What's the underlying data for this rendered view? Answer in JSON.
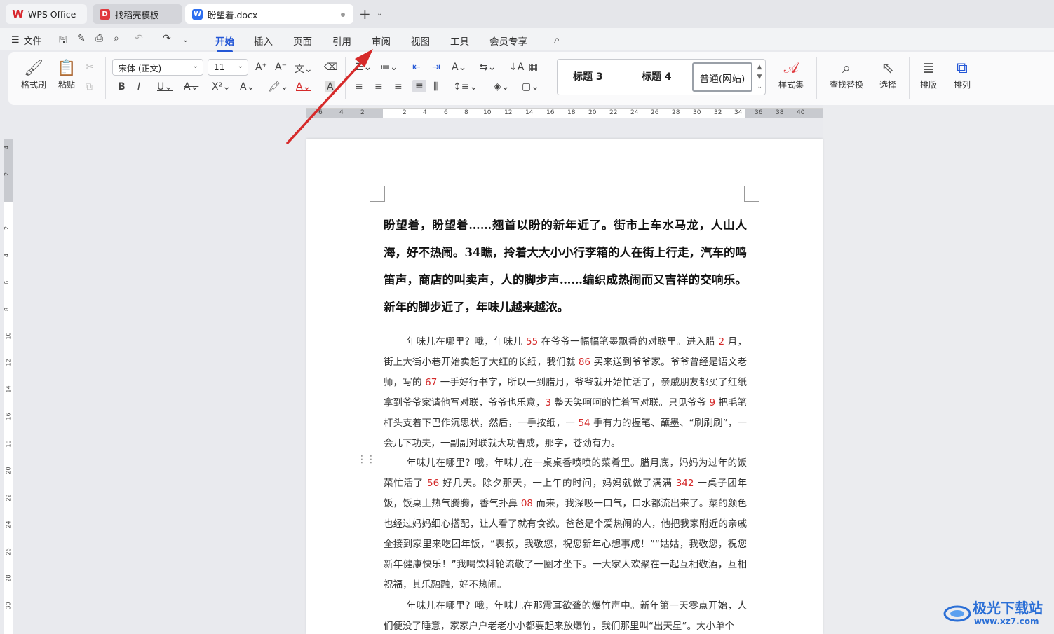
{
  "tabs": [
    {
      "label": "WPS Office",
      "icon": "wps-logo-icon"
    },
    {
      "label": "找稻壳模板",
      "icon": "docer-icon"
    },
    {
      "label": "盼望着.docx",
      "icon": "word-doc-icon"
    }
  ],
  "menu": {
    "file": "文件",
    "tabs": [
      "开始",
      "插入",
      "页面",
      "引用",
      "审阅",
      "视图",
      "工具",
      "会员专享"
    ],
    "active_tab": "开始"
  },
  "ribbon": {
    "format_painter": "格式刷",
    "paste": "粘贴",
    "font_name": "宋体 (正文)",
    "font_size": "11",
    "styles": [
      "标题 3",
      "标题 4",
      "普通(网站)"
    ],
    "style_set": "样式集",
    "find_replace": "查找替换",
    "select": "选择",
    "layout": "排版",
    "arrange": "排列"
  },
  "ruler": {
    "h_numbers": [
      "6",
      "4",
      "2",
      "2",
      "4",
      "6",
      "8",
      "10",
      "12",
      "14",
      "16",
      "18",
      "20",
      "22",
      "24",
      "26",
      "28",
      "30",
      "32",
      "34",
      "36",
      "38",
      "40"
    ],
    "v_numbers": [
      "4",
      "2",
      "2",
      "4",
      "6",
      "8",
      "10",
      "12",
      "14",
      "16",
      "18",
      "20",
      "22",
      "24",
      "26",
      "28",
      "30"
    ]
  },
  "document": {
    "heading": "盼望着，盼望着……翘首以盼的新年近了。街市上车水马龙，人山人海，好不热闹。34瞧，拎着大大小小行李箱的人在街上行走，汽车的鸣笛声，商店的叫卖声，人的脚步声……编织成热闹而又吉祥的交响乐。新年的脚步近了，年味儿越来越浓。",
    "p1": [
      {
        "t": "年味儿在哪里？哦，年味儿 "
      },
      {
        "t": "55",
        "red": true
      },
      {
        "t": " 在爷爷一幅幅笔墨飘香的对联里。进入腊 "
      },
      {
        "t": "2",
        "red": true
      },
      {
        "t": " 月，街上大街小巷开始卖起了大红的长纸，我们就 "
      },
      {
        "t": "86",
        "red": true
      },
      {
        "t": " 买来送到爷爷家。爷爷曾经是语文老师，写的 "
      },
      {
        "t": "67",
        "red": true
      },
      {
        "t": " 一手好行书字，所以一到腊月，爷爷就开始忙活了，亲戚朋友都买了红纸拿到爷爷家请他写对联，爷爷也乐意，"
      },
      {
        "t": "3",
        "red": true
      },
      {
        "t": " 整天笑呵呵的忙着写对联。只见爷爷 "
      },
      {
        "t": "9",
        "red": true
      },
      {
        "t": " 把毛笔杆头支着下巴作沉思状，然后，一手按纸，一 "
      },
      {
        "t": "54",
        "red": true
      },
      {
        "t": " 手有力的握笔、蘸墨、“刷刷刷”，一会儿下功夫，一副副对联就大功告成，那字，苍劲有力。"
      }
    ],
    "p2": [
      {
        "t": "年味儿在哪里？哦，年味儿在一桌桌香喷喷的菜肴里。腊月底，妈妈为过年的饭菜忙活了 "
      },
      {
        "t": "56",
        "red": true
      },
      {
        "t": " 好几天。除夕那天，一上午的时间，妈妈就做了满满 "
      },
      {
        "t": "342",
        "red": true
      },
      {
        "t": " 一桌子团年饭，饭桌上热气腾腾，香气扑鼻 "
      },
      {
        "t": "08",
        "red": true
      },
      {
        "t": " 而来，我深吸一口气，口水都流出来了。菜的颜色也经过妈妈细心搭配，让人看了就有食欲。爸爸是个爱热闹的人，他把我家附近的亲戚全接到家里来吃团年饭，“表叔，我敬您，祝您新年心想事成！”“姑姑，我敬您，祝您新年健康快乐！”我喝饮料轮流敬了一圈才坐下。一大家人欢聚在一起互相敬酒，互相祝福，其乐融融，好不热闹。"
      }
    ],
    "p3": "年味儿在哪里？哦，年味儿在那震耳欲聋的爆竹声中。新年第一天零点开始，人们便没了睡意，家家户户老老小小都要起来放爆竹，我们那里叫“出天星”。大小单个"
  },
  "watermark": {
    "name": "极光下载站",
    "url": "www.xz7.com"
  },
  "colors": {
    "accent": "#2457d6",
    "red_text": "#d42a2a",
    "arrow": "#d62a2a"
  }
}
